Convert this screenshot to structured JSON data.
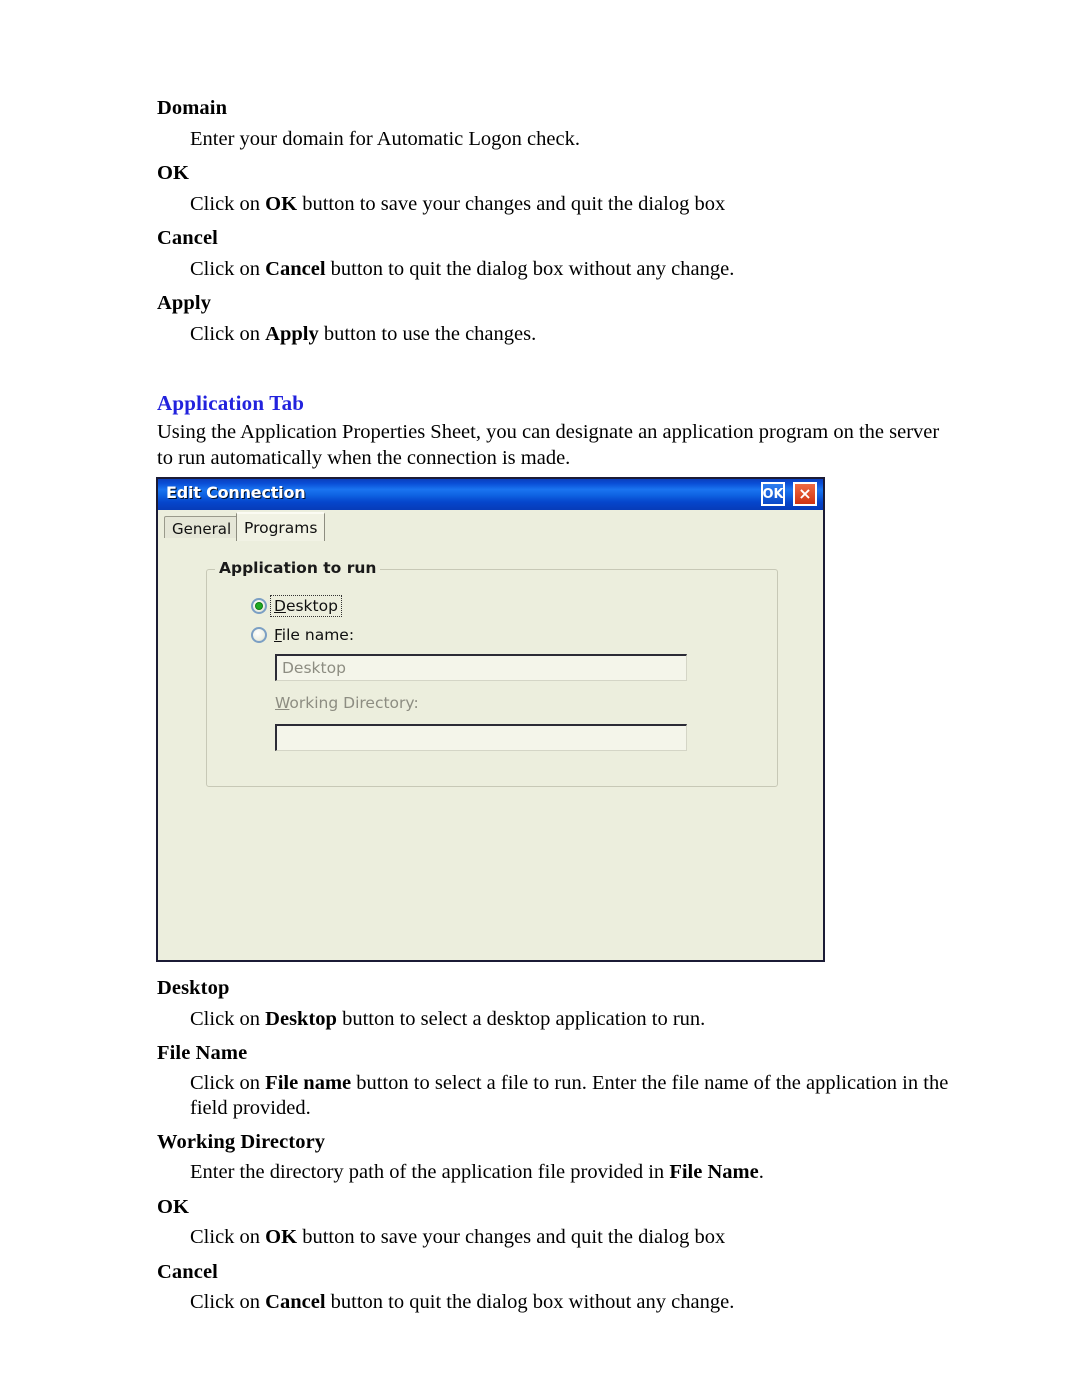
{
  "document": {
    "entries": [
      {
        "term": "Domain",
        "body_html": "Enter your domain for Automatic Logon check."
      },
      {
        "term": "OK",
        "body_html": "Click on <b>OK</b> button to save your changes and quit the dialog box"
      },
      {
        "term": "Cancel",
        "body_html": "Click on <b>Cancel</b> button to quit the dialog box without any change."
      },
      {
        "term": "Apply",
        "body_html": "Click on <b>Apply</b> button to use the changes."
      }
    ],
    "section_heading": "Application Tab",
    "intro_paragraph": "Using the Application Properties Sheet, you can designate an application program on the server to run automatically when the connection is made.",
    "entries_after": [
      {
        "term": "Desktop",
        "body_html": "Click on <b>Desktop</b> button to select a desktop application to run."
      },
      {
        "term": "File Name",
        "body_html": "Click on <b>File name</b> button to select a file to run. Enter the file name of the application in the field provided."
      },
      {
        "term": "Working Directory",
        "body_html": "Enter the directory path of the application file provided in <b>File Name</b>."
      },
      {
        "term": "OK",
        "body_html": "Click on <b>OK</b> button to save your changes and quit the dialog box"
      },
      {
        "term": "Cancel",
        "body_html": "Click on <b>Cancel</b> button to quit the dialog box without any change."
      }
    ],
    "heading_color": "#2222dd"
  },
  "dialog": {
    "title": "Edit Connection",
    "titlebar_ok_label": "OK",
    "titlebar_close_label": "×",
    "tabs": [
      {
        "label": "General",
        "active": false
      },
      {
        "label": "Programs",
        "active": true
      }
    ],
    "group": {
      "title": "Application to run",
      "desktop_radio": {
        "label_prefix": "",
        "accel": "D",
        "label_rest": "esktop",
        "checked": true,
        "focused": true
      },
      "filename_radio": {
        "accel": "F",
        "label_rest": "ile name:",
        "checked": false,
        "focused": false
      },
      "filename_field_value": "Desktop",
      "working_directory_label_accel": "W",
      "working_directory_label_rest": "orking Directory:",
      "working_directory_value": ""
    },
    "colors": {
      "titlebar_blue": "#0f63e2",
      "body_beige": "#eceedd",
      "radio_green": "#1faa22",
      "close_red": "#cf3312"
    }
  }
}
